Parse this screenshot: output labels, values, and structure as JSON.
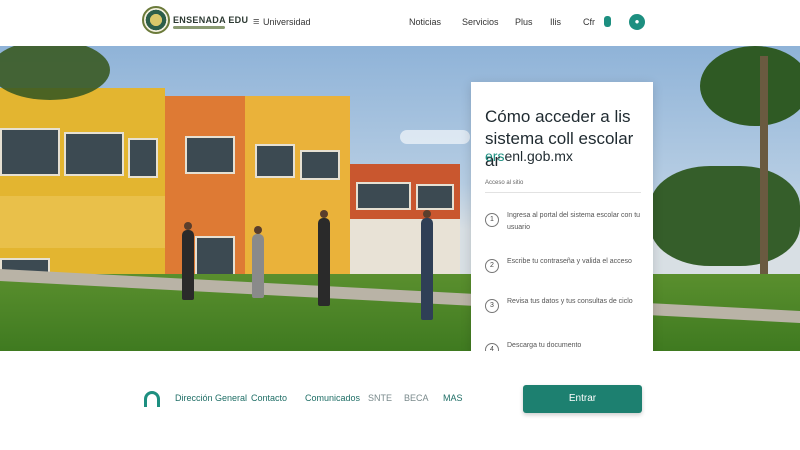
{
  "header": {
    "brand": "ENSENADA EDU",
    "section": "Universidad",
    "nav": [
      "Noticias",
      "Servicios",
      "Plus",
      "Ilis",
      "Cfr"
    ],
    "menu_icon_label": "≡"
  },
  "hero": {
    "card": {
      "title": "Cómo acceder a lis sistema coll escolar ar",
      "url_accent": "ers",
      "url_rest": "enl.gob.mx",
      "label": "Acceso al sitio",
      "steps": [
        {
          "num": "1",
          "text": "Ingresa al portal del sistema escolar con tu usuario"
        },
        {
          "num": "2",
          "text": "Escribe tu contraseña y valida el acceso"
        },
        {
          "num": "3",
          "text": "Revisa tus datos y tus consultas de ciclo"
        },
        {
          "num": "4",
          "text": "Descarga tu documento"
        }
      ]
    }
  },
  "footer": {
    "links": [
      "Dirección General",
      "Contacto",
      "Comunicados",
      "SNTE",
      "BECA",
      "MAS"
    ],
    "cta_label": "Entrar"
  },
  "colors": {
    "accent": "#1d8f80",
    "cta": "#1d8070"
  },
  "icons": [
    "logo-emblem",
    "menu-icon",
    "user-icon",
    "step-number-icon",
    "home-arch-icon"
  ]
}
